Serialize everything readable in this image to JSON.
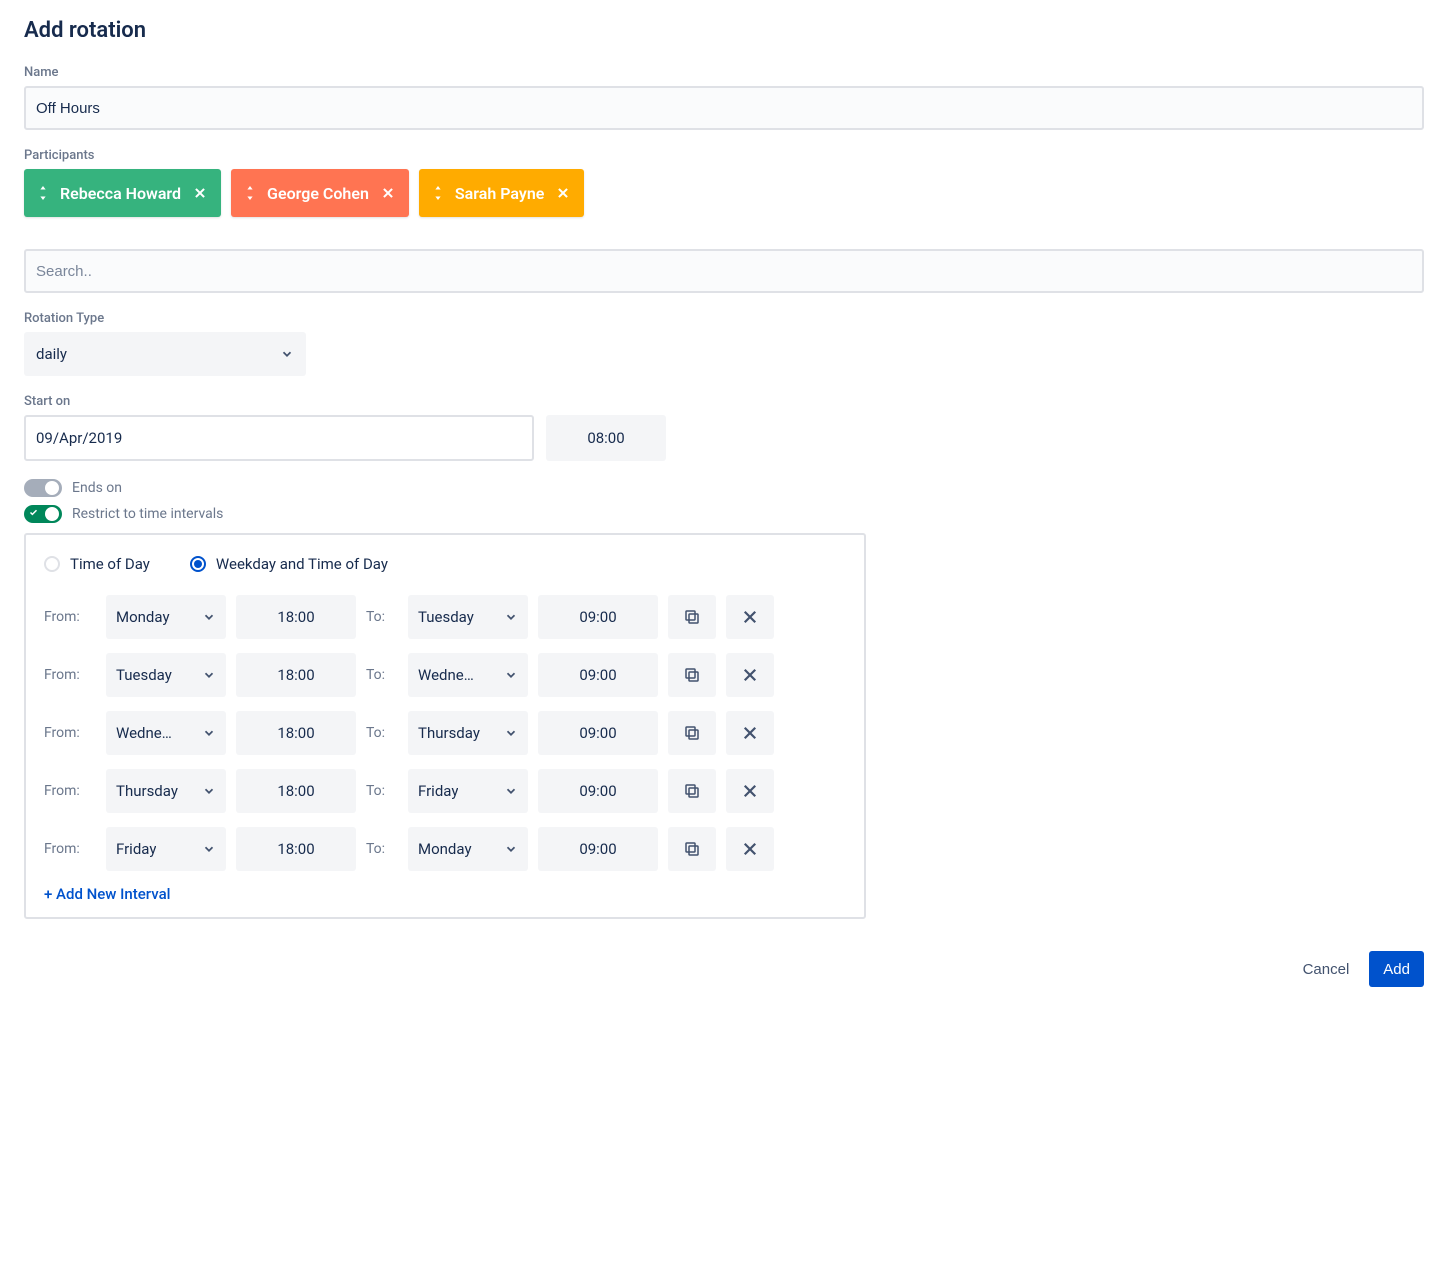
{
  "dialog": {
    "title": "Add rotation"
  },
  "name": {
    "label": "Name",
    "value": "Off Hours"
  },
  "participants": {
    "label": "Participants",
    "chips": [
      {
        "name": "Rebecca Howard",
        "color": "chip-green"
      },
      {
        "name": "George Cohen",
        "color": "chip-orange-red"
      },
      {
        "name": "Sarah Payne",
        "color": "chip-orange"
      }
    ],
    "search_placeholder": "Search.."
  },
  "rotation_type": {
    "label": "Rotation Type",
    "value": "daily"
  },
  "start": {
    "label": "Start on",
    "date": "09/Apr/2019",
    "time": "08:00"
  },
  "ends_on": {
    "label": "Ends on",
    "enabled": false
  },
  "restrict": {
    "label": "Restrict to time intervals",
    "enabled": true
  },
  "interval_mode": {
    "options": [
      {
        "label": "Time of Day",
        "selected": false
      },
      {
        "label": "Weekday and Time of Day",
        "selected": true
      }
    ]
  },
  "intervals": {
    "from_label": "From:",
    "to_label": "To:",
    "rows": [
      {
        "from_day": "Monday",
        "from_time": "18:00",
        "to_day": "Tuesday",
        "to_time": "09:00"
      },
      {
        "from_day": "Tuesday",
        "from_time": "18:00",
        "to_day": "Wedne…",
        "to_time": "09:00"
      },
      {
        "from_day": "Wedne…",
        "from_time": "18:00",
        "to_day": "Thursday",
        "to_time": "09:00"
      },
      {
        "from_day": "Thursday",
        "from_time": "18:00",
        "to_day": "Friday",
        "to_time": "09:00"
      },
      {
        "from_day": "Friday",
        "from_time": "18:00",
        "to_day": "Monday",
        "to_time": "09:00"
      }
    ],
    "add_label": "+ Add New Interval"
  },
  "footer": {
    "cancel": "Cancel",
    "submit": "Add"
  }
}
